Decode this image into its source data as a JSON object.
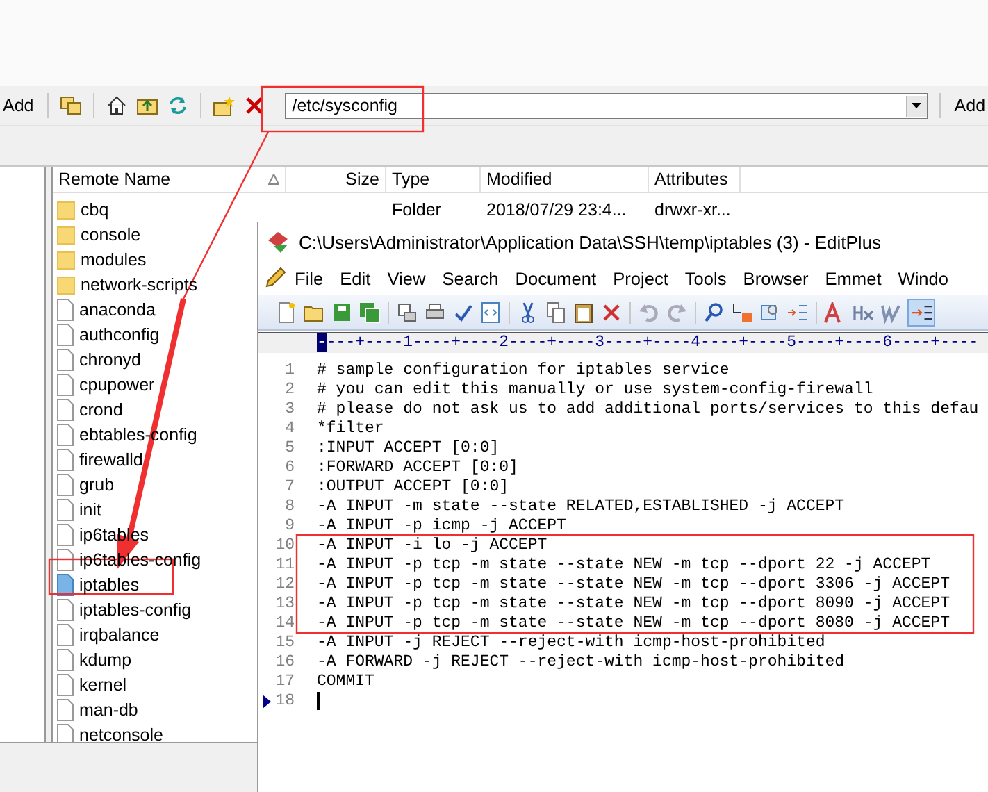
{
  "toolbar": {
    "left_button": "Add",
    "path": "/etc/sysconfig",
    "add_button": "Add"
  },
  "file_list": {
    "columns": [
      "Remote Name",
      "Size",
      "Type",
      "Modified",
      "Attributes"
    ],
    "rows": [
      {
        "name": "cbq",
        "kind": "folder",
        "selected": false,
        "type": "Folder",
        "modified": "2018/07/29 23:4...",
        "attributes": "drwxr-xr..."
      },
      {
        "name": "console",
        "kind": "folder",
        "selected": false
      },
      {
        "name": "modules",
        "kind": "folder",
        "selected": false
      },
      {
        "name": "network-scripts",
        "kind": "folder",
        "selected": false
      },
      {
        "name": "anaconda",
        "kind": "file",
        "selected": false
      },
      {
        "name": "authconfig",
        "kind": "file",
        "selected": false
      },
      {
        "name": "chronyd",
        "kind": "file",
        "selected": false
      },
      {
        "name": "cpupower",
        "kind": "file",
        "selected": false
      },
      {
        "name": "crond",
        "kind": "file",
        "selected": false
      },
      {
        "name": "ebtables-config",
        "kind": "file",
        "selected": false
      },
      {
        "name": "firewalld",
        "kind": "file",
        "selected": false
      },
      {
        "name": "grub",
        "kind": "file",
        "selected": false
      },
      {
        "name": "init",
        "kind": "file",
        "selected": false
      },
      {
        "name": "ip6tables",
        "kind": "file",
        "selected": false
      },
      {
        "name": "ip6tables-config",
        "kind": "file",
        "selected": false
      },
      {
        "name": "iptables",
        "kind": "file",
        "selected": true
      },
      {
        "name": "iptables-config",
        "kind": "file",
        "selected": false
      },
      {
        "name": "irqbalance",
        "kind": "file",
        "selected": false
      },
      {
        "name": "kdump",
        "kind": "file",
        "selected": false
      },
      {
        "name": "kernel",
        "kind": "file",
        "selected": false
      },
      {
        "name": "man-db",
        "kind": "file",
        "selected": false
      },
      {
        "name": "netconsole",
        "kind": "file",
        "selected": false
      }
    ]
  },
  "editor": {
    "title": "C:\\Users\\Administrator\\Application Data\\SSH\\temp\\iptables (3) - EditPlus",
    "menu": [
      "File",
      "Edit",
      "View",
      "Search",
      "Document",
      "Project",
      "Tools",
      "Browser",
      "Emmet",
      "Windo"
    ],
    "ruler": "----+----1----+----2----+----3----+----4----+----5----+----6----+----",
    "lines": [
      {
        "number": "1",
        "text": "# sample configuration for iptables service",
        "current": false
      },
      {
        "number": "2",
        "text": "# you can edit this manually or use system-config-firewall",
        "current": false
      },
      {
        "number": "3",
        "text": "# please do not ask us to add additional ports/services to this defau",
        "current": false
      },
      {
        "number": "4",
        "text": "*filter",
        "current": false
      },
      {
        "number": "5",
        "text": ":INPUT ACCEPT [0:0]",
        "current": false
      },
      {
        "number": "6",
        "text": ":FORWARD ACCEPT [0:0]",
        "current": false
      },
      {
        "number": "7",
        "text": ":OUTPUT ACCEPT [0:0]",
        "current": false
      },
      {
        "number": "8",
        "text": "-A INPUT -m state --state RELATED,ESTABLISHED -j ACCEPT",
        "current": false
      },
      {
        "number": "9",
        "text": "-A INPUT -p icmp -j ACCEPT",
        "current": false
      },
      {
        "number": "10",
        "text": "-A INPUT -i lo -j ACCEPT",
        "current": false
      },
      {
        "number": "11",
        "text": "-A INPUT -p tcp -m state --state NEW -m tcp --dport 22 -j ACCEPT",
        "current": false
      },
      {
        "number": "12",
        "text": "-A INPUT -p tcp -m state --state NEW -m tcp --dport 3306 -j ACCEPT",
        "current": false
      },
      {
        "number": "13",
        "text": "-A INPUT -p tcp -m state --state NEW -m tcp --dport 8090 -j ACCEPT",
        "current": false
      },
      {
        "number": "14",
        "text": "-A INPUT -p tcp -m state --state NEW -m tcp --dport 8080 -j ACCEPT",
        "current": false
      },
      {
        "number": "15",
        "text": "-A INPUT -j REJECT --reject-with icmp-host-prohibited",
        "current": false
      },
      {
        "number": "16",
        "text": "-A FORWARD -j REJECT --reject-with icmp-host-prohibited",
        "current": false
      },
      {
        "number": "17",
        "text": "COMMIT",
        "current": false
      },
      {
        "number": "18",
        "current": true
      }
    ]
  }
}
